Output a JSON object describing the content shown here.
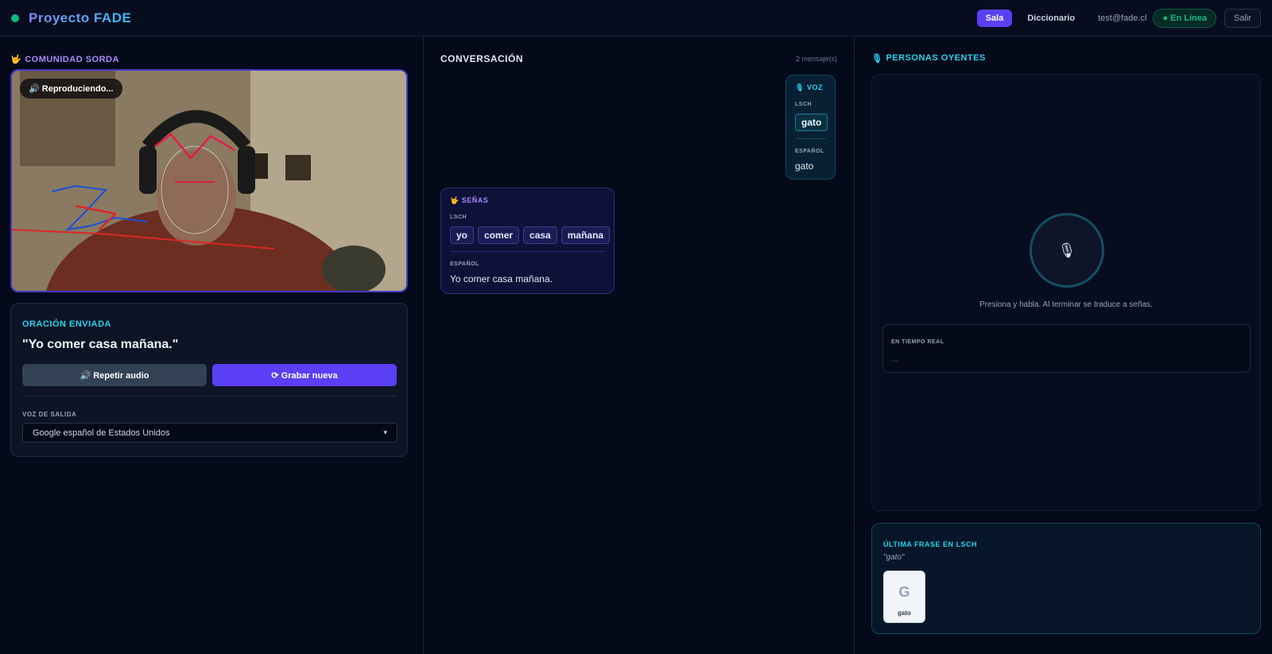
{
  "header": {
    "brand": "Proyecto FADE",
    "nav": {
      "room": "Sala",
      "dictionary": "Diccionario"
    },
    "user_email": "test@fade.cl",
    "status": "● En Línea",
    "logout": "Salir"
  },
  "left": {
    "title": "COMUNIDAD SORDA",
    "title_icon": "🤟",
    "video": {
      "playing_badge": "🔊 Reproduciendo..."
    },
    "sent": {
      "title": "ORACIÓN ENVIADA",
      "sentence": "\"Yo comer casa mañana.\"",
      "repeat_label": "🔊 Repetir audio",
      "record_label": "⟳ Grabar nueva",
      "voice_label": "VOZ DE SALIDA",
      "voice_value": "Google español de Estados Unidos"
    }
  },
  "middle": {
    "title": "CONVERSACIÓN",
    "count": "2 mensaje(s)",
    "messages": [
      {
        "kind": "VOZ",
        "icon": "🎙",
        "lsch_label": "LSCH",
        "signs": [
          "gato"
        ],
        "spanish_label": "ESPAÑOL",
        "spanish": "gato"
      },
      {
        "kind": "SEÑAS",
        "icon": "🤟",
        "lsch_label": "LSCH",
        "signs": [
          "yo",
          "comer",
          "casa",
          "mañana"
        ],
        "spanish_label": "ESPAÑOL",
        "spanish": "Yo comer casa mañana."
      }
    ]
  },
  "right": {
    "title": "PERSONAS OYENTES",
    "title_icon": "🎙",
    "mic_icon": "🎙",
    "hint": "Presiona y habla. Al terminar se traduce a señas.",
    "realtime_label": "EN TIEMPO REAL",
    "realtime_value": "...",
    "last": {
      "title": "ÚLTIMA FRASE EN LSCH",
      "quote": "\"gato\"",
      "card_letter": "G",
      "card_word": "gato"
    }
  },
  "colors": {
    "accent": "#5b3ff5",
    "online": "#10b981",
    "cyan": "#22d3ee",
    "purple": "#a78bfa"
  }
}
